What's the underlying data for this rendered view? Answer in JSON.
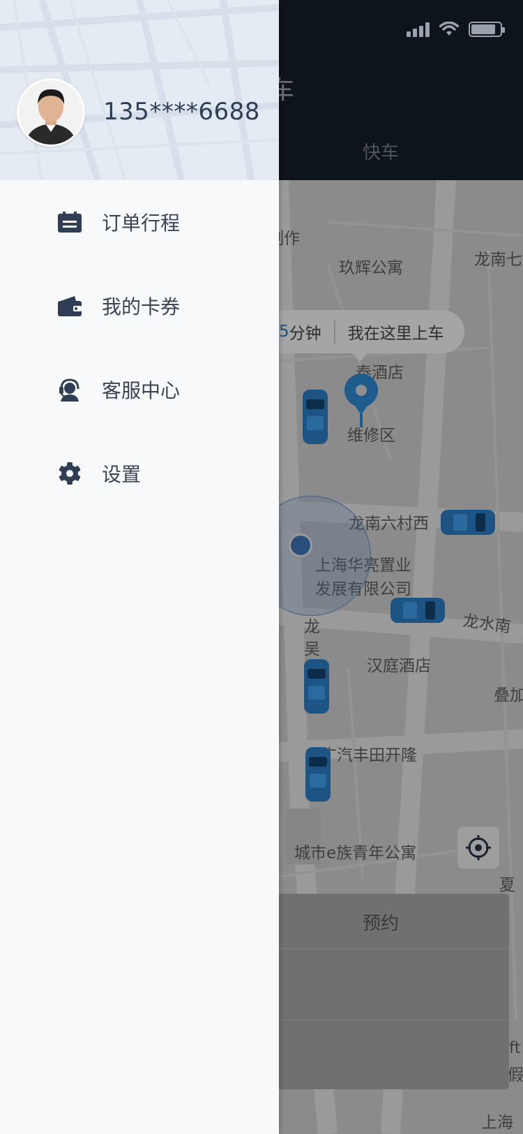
{
  "status_bar": {
    "signal": "signal-icon",
    "wifi": "wifi-icon",
    "battery": "battery-icon"
  },
  "background_app": {
    "title_partial": "约车",
    "tab": "快车",
    "pickup": {
      "minutes_partial": "5",
      "minutes_unit": "分钟",
      "action": "我在这里上车"
    },
    "map_labels": [
      "制作",
      "玖辉公寓",
      "龙南七",
      "泰酒店",
      "维修区",
      "龙南六村西",
      "上海华亮置业",
      "发展有限公司",
      "龙",
      "吴",
      "龙水南",
      "汉庭酒店",
      "叠加",
      "广汽丰田开隆",
      "城市e族青年公寓",
      "夏",
      "上海",
      "ft",
      "假"
    ],
    "bottom_card": {
      "tab": "预约"
    },
    "locate_icon": "crosshair-icon"
  },
  "drawer": {
    "phone": "135****6688",
    "menu": [
      {
        "label": "订单行程",
        "icon": "order-list-icon"
      },
      {
        "label": "我的卡券",
        "icon": "wallet-icon"
      },
      {
        "label": "客服中心",
        "icon": "headset-icon"
      },
      {
        "label": "设置",
        "icon": "gear-icon"
      }
    ]
  },
  "colors": {
    "drawer_bg": "#f8f9fa",
    "drawer_header_bg": "#e4ebf3",
    "menu_icon": "#2f3e55",
    "accent": "#1f5c8e",
    "app_header_bg": "#0e141c"
  }
}
